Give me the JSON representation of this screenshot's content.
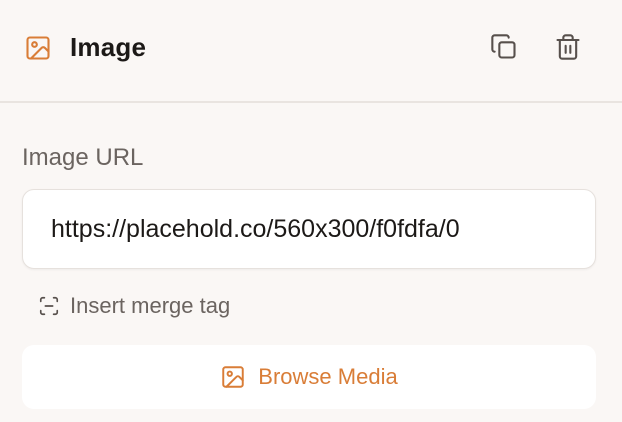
{
  "block": {
    "title": "Image",
    "title_icon": "image-icon",
    "actions": [
      {
        "name": "duplicate",
        "icon": "copy-icon"
      },
      {
        "name": "delete",
        "icon": "trash-icon"
      }
    ]
  },
  "image_url_field": {
    "label": "Image URL",
    "value": "https://placehold.co/560x300/f0fdfa/0"
  },
  "merge_tag": {
    "label": "Insert merge tag",
    "icon": "merge-tag-icon"
  },
  "browse_media": {
    "label": "Browse Media",
    "icon": "image-icon"
  },
  "colors": {
    "accent": "#d97d37",
    "background": "#faf7f5",
    "muted_text": "#6b6460",
    "border": "#e6e1dd"
  }
}
